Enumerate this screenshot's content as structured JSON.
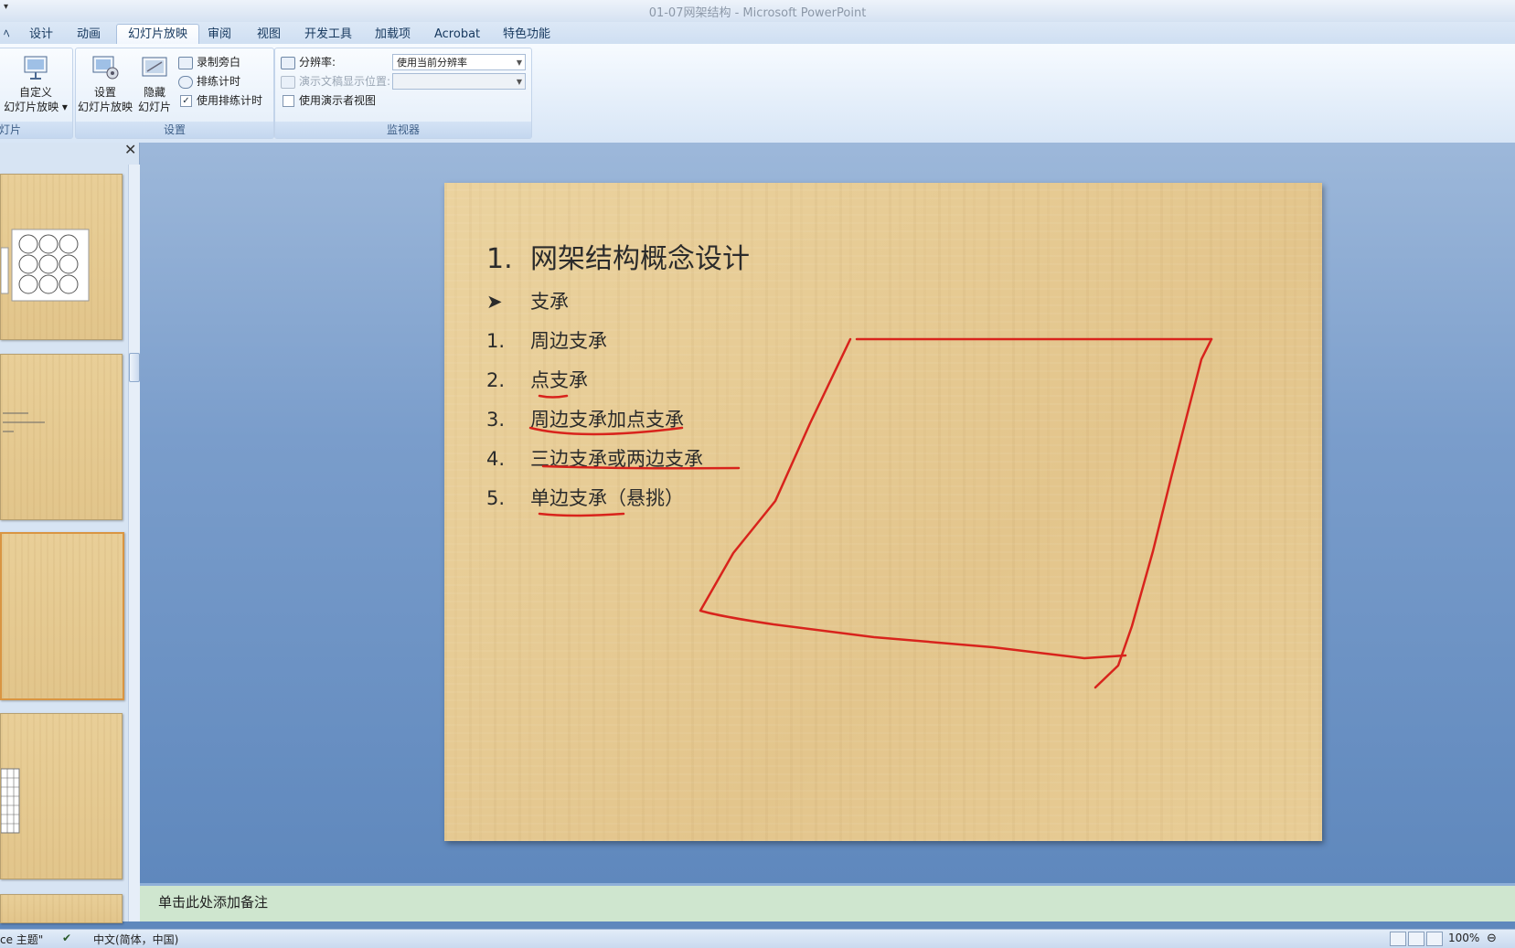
{
  "window": {
    "title": "01-07网架结构 - Microsoft PowerPoint"
  },
  "tabs": [
    {
      "label": "设计"
    },
    {
      "label": "动画"
    },
    {
      "label": "幻灯片放映"
    },
    {
      "label": "审阅"
    },
    {
      "label": "视图"
    },
    {
      "label": "开发工具"
    },
    {
      "label": "加载项"
    },
    {
      "label": "Acrobat"
    },
    {
      "label": "特色功能"
    }
  ],
  "ribbon": {
    "group_start": {
      "label": "灯片",
      "btn_line1": "自定义",
      "btn_line2": "幻灯片放映 ▾"
    },
    "group_setup": {
      "label": "设置",
      "setup_line1": "设置",
      "setup_line2": "幻灯片放映",
      "hide_line1": "隐藏",
      "hide_line2": "幻灯片",
      "record": "录制旁白",
      "rehearse": "排练计时",
      "use_timings": "使用排练计时"
    },
    "group_monitor": {
      "label": "监视器",
      "resolution_label": "分辨率:",
      "resolution_value": "使用当前分辨率",
      "show_on_label": "演示文稿显示位置:",
      "presenter_view": "使用演示者视图"
    }
  },
  "slide": {
    "title_num": "1.",
    "title": "网架结构概念设计",
    "bullet_glyph": "➤",
    "bullet": "支承",
    "items": [
      {
        "num": "1.",
        "text": "周边支承"
      },
      {
        "num": "2.",
        "text": "点支承"
      },
      {
        "num": "3.",
        "text": "周边支承加点支承"
      },
      {
        "num": "4.",
        "text": "三边支承或两边支承"
      },
      {
        "num": "5.",
        "text": "单边支承（悬挑）"
      }
    ],
    "ink_color": "#d8231c"
  },
  "notes": {
    "placeholder": "单击此处添加备注"
  },
  "status": {
    "theme": "ce 主题\"",
    "language": "中文(简体，中国)",
    "zoom": "100%"
  }
}
